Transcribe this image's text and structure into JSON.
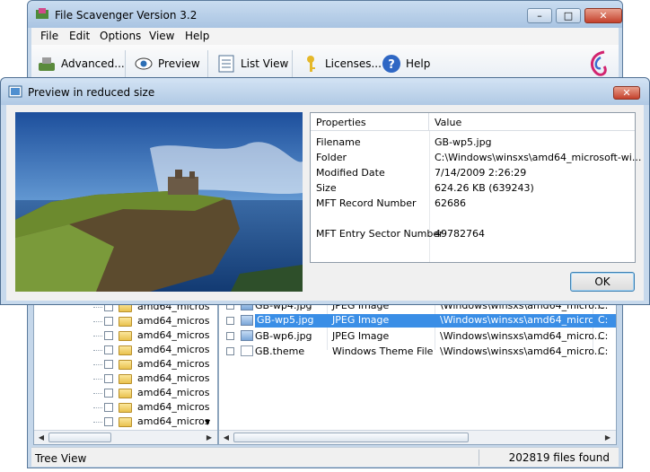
{
  "main_window": {
    "title": "File Scavenger Version 3.2",
    "menu": [
      "File",
      "Edit",
      "Options",
      "View",
      "Help"
    ],
    "toolbar": [
      {
        "label": "Advanced...",
        "icon": "tools-icon"
      },
      {
        "label": "Preview",
        "icon": "eye-icon"
      },
      {
        "label": "List View",
        "icon": "list-icon"
      },
      {
        "label": "Licenses...",
        "icon": "key-icon"
      },
      {
        "label": "Help",
        "icon": "help-icon"
      }
    ],
    "tree_items": [
      "amd64_micros",
      "amd64_micros",
      "amd64_micros",
      "amd64_micros",
      "amd64_micros",
      "amd64_micros",
      "amd64_micros",
      "amd64_micros",
      "amd64_micros"
    ],
    "file_rows": [
      {
        "name": "GB-wp4.jpg",
        "type": "JPEG Image",
        "folder": "\\Windows\\winsxs\\amd64_micro...",
        "drive": "C:",
        "selected": false
      },
      {
        "name": "GB-wp5.jpg",
        "type": "JPEG Image",
        "folder": "\\Windows\\winsxs\\amd64_micro...",
        "drive": "C:",
        "selected": true
      },
      {
        "name": "GB-wp6.jpg",
        "type": "JPEG Image",
        "folder": "\\Windows\\winsxs\\amd64_micro...",
        "drive": "C:",
        "selected": false
      },
      {
        "name": "GB.theme",
        "type": "Windows Theme File",
        "folder": "\\Windows\\winsxs\\amd64_micro...",
        "drive": "C:",
        "selected": false
      }
    ],
    "status_left": "Tree View",
    "status_right": "202819 files found"
  },
  "dialog": {
    "title": "Preview in reduced size",
    "props_header": {
      "col1": "Properties",
      "col2": "Value"
    },
    "properties": [
      {
        "name": "Filename",
        "value": "GB-wp5.jpg"
      },
      {
        "name": "Folder",
        "value": "C:\\Windows\\winsxs\\amd64_microsoft-wi..."
      },
      {
        "name": "Modified Date",
        "value": "7/14/2009 2:26:29"
      },
      {
        "name": "Size",
        "value": "624.26 KB (639243)"
      },
      {
        "name": "MFT Record Number",
        "value": "62686"
      },
      {
        "name": "",
        "value": ""
      },
      {
        "name": "MFT Entry Sector Number",
        "value": "49782764"
      }
    ],
    "ok_label": "OK"
  },
  "colors": {
    "selection": "#3a8ee6",
    "title_bar": "#b0c9e4",
    "close_button": "#c4412c"
  }
}
